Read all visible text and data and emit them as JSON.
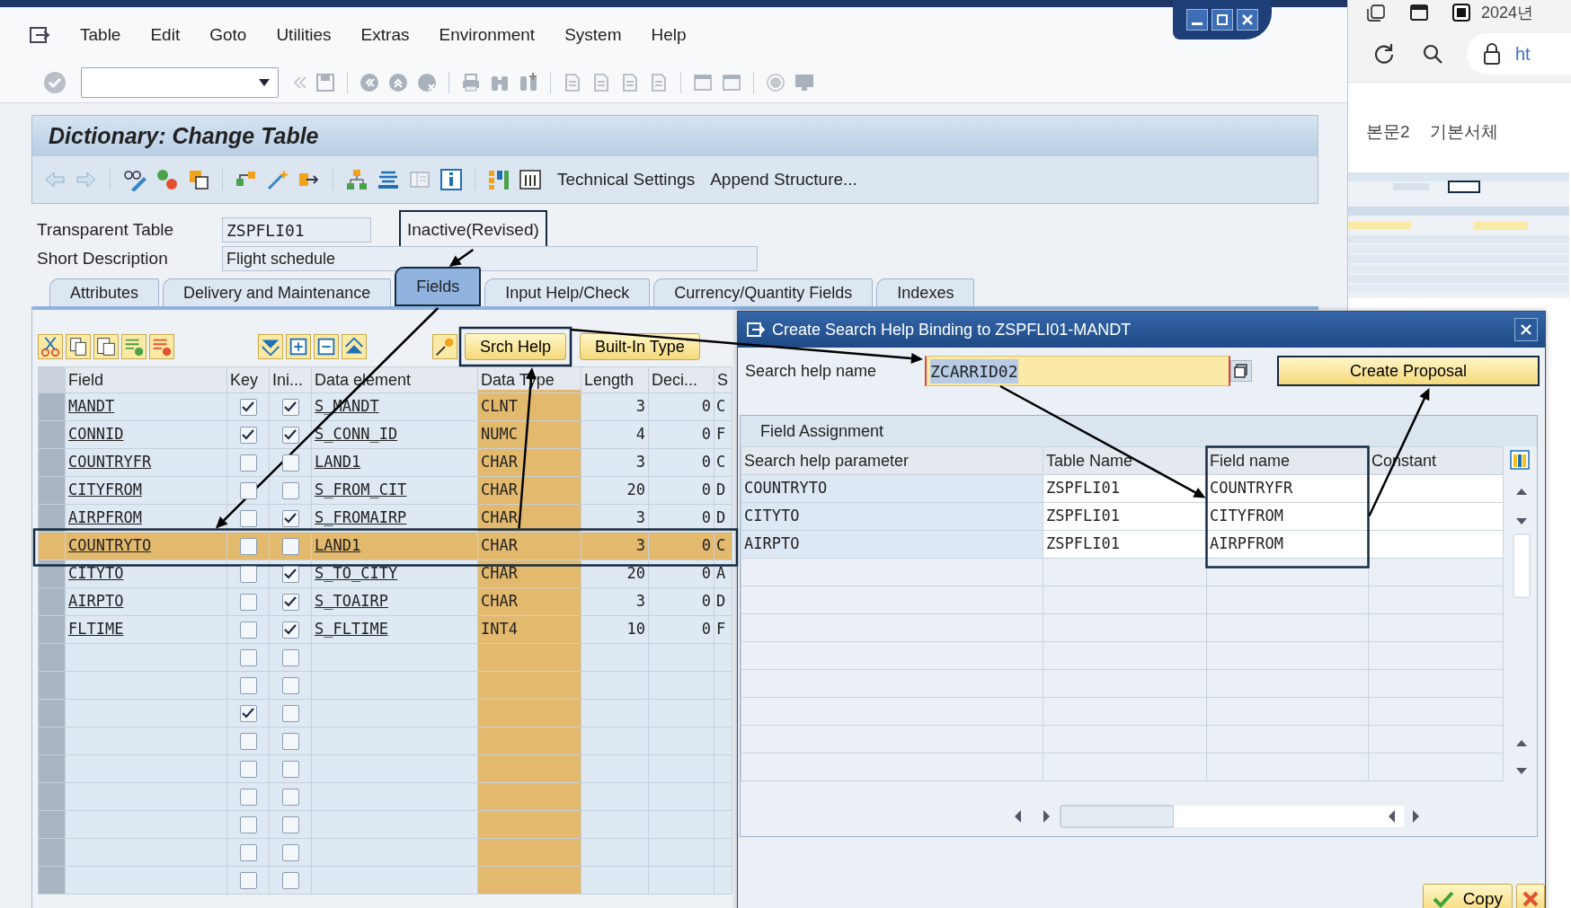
{
  "menu": [
    "Table",
    "Edit",
    "Goto",
    "Utilities",
    "Extras",
    "Environment",
    "System",
    "Help"
  ],
  "screen_title": "Dictionary: Change Table",
  "app_toolbar": [
    "Technical Settings",
    "Append Structure..."
  ],
  "header_fields": [
    {
      "label": "Transparent Table",
      "value": "ZSPFLI01",
      "status": "Inactive(Revised)"
    },
    {
      "label": "Short Description",
      "value": "Flight schedule"
    }
  ],
  "tabs": [
    {
      "label": "Attributes",
      "selected": false
    },
    {
      "label": "Delivery and Maintenance",
      "selected": false
    },
    {
      "label": "Fields",
      "selected": true
    },
    {
      "label": "Input Help/Check",
      "selected": false
    },
    {
      "label": "Currency/Quantity Fields",
      "selected": false
    },
    {
      "label": "Indexes",
      "selected": false
    }
  ],
  "grid_buttons": [
    "Srch Help",
    "Built-In Type"
  ],
  "grid": {
    "columns": [
      {
        "label": "Field",
        "highlighted": false
      },
      {
        "label": "Key",
        "highlighted": false
      },
      {
        "label": "Ini...",
        "highlighted": false
      },
      {
        "label": "Data element",
        "highlighted": false
      },
      {
        "label": "Data Type",
        "highlighted": true
      },
      {
        "label": "Length",
        "highlighted": false
      },
      {
        "label": "Deci...",
        "highlighted": false
      },
      {
        "label": "S",
        "highlighted": false
      }
    ],
    "rows": [
      {
        "field": "MANDT",
        "key": true,
        "initial": true,
        "data_element": "S_MANDT",
        "data_type": "CLNT",
        "length": "3",
        "decimals": "0",
        "short_text": "C",
        "selected": false
      },
      {
        "field": "CONNID",
        "key": true,
        "initial": true,
        "data_element": "S_CONN_ID",
        "data_type": "NUMC",
        "length": "4",
        "decimals": "0",
        "short_text": "F",
        "selected": false
      },
      {
        "field": "COUNTRYFR",
        "key": false,
        "initial": false,
        "data_element": "LAND1",
        "data_type": "CHAR",
        "length": "3",
        "decimals": "0",
        "short_text": "C",
        "selected": false
      },
      {
        "field": "CITYFROM",
        "key": false,
        "initial": false,
        "data_element": "S_FROM_CIT",
        "data_type": "CHAR",
        "length": "20",
        "decimals": "0",
        "short_text": "D",
        "selected": false
      },
      {
        "field": "AIRPFROM",
        "key": false,
        "initial": true,
        "data_element": "S_FROMAIRP",
        "data_type": "CHAR",
        "length": "3",
        "decimals": "0",
        "short_text": "D",
        "selected": false
      },
      {
        "field": "COUNTRYTO",
        "key": false,
        "initial": false,
        "data_element": "LAND1",
        "data_type": "CHAR",
        "length": "3",
        "decimals": "0",
        "short_text": "C",
        "selected": true
      },
      {
        "field": "CITYTO",
        "key": false,
        "initial": true,
        "data_element": "S_TO_CITY",
        "data_type": "CHAR",
        "length": "20",
        "decimals": "0",
        "short_text": "A",
        "selected": false
      },
      {
        "field": "AIRPTO",
        "key": false,
        "initial": true,
        "data_element": "S_TOAIRP",
        "data_type": "CHAR",
        "length": "3",
        "decimals": "0",
        "short_text": "D",
        "selected": false
      },
      {
        "field": "FLTIME",
        "key": false,
        "initial": true,
        "data_element": "S_FLTIME",
        "data_type": "INT4",
        "length": "10",
        "decimals": "0",
        "short_text": "F",
        "selected": false
      },
      {
        "key": false,
        "initial": false,
        "selected": false
      },
      {
        "key": false,
        "initial": false,
        "selected": false
      },
      {
        "key": true,
        "initial": false,
        "selected": false
      },
      {
        "key": false,
        "initial": false,
        "selected": false
      },
      {
        "key": false,
        "initial": false,
        "selected": false
      },
      {
        "key": false,
        "initial": false,
        "selected": false
      },
      {
        "key": false,
        "initial": false,
        "selected": false
      },
      {
        "key": false,
        "initial": false,
        "selected": false
      },
      {
        "key": false,
        "initial": false,
        "selected": false
      }
    ]
  },
  "dialog": {
    "title": "Create Search Help Binding to ZSPFLI01-MANDT",
    "search_help": {
      "label": "Search help name",
      "value": "ZCARRID02"
    },
    "create_button": "Create Proposal",
    "panel_title": "Field Assignment",
    "columns": [
      "Search help parameter",
      "Table Name",
      "Field name",
      "Constant"
    ],
    "rows": [
      {
        "parameter": "COUNTRYTO",
        "table": "ZSPFLI01",
        "field": "COUNTRYFR"
      },
      {
        "parameter": "CITYTO",
        "table": "ZSPFLI01",
        "field": "CITYFROM"
      },
      {
        "parameter": "AIRPTO",
        "table": "ZSPFLI01",
        "field": "AIRPFROM"
      }
    ],
    "copy_button": "Copy"
  },
  "browser": {
    "tab_title": "2024년",
    "address": "ht",
    "toolbar": [
      "본문2",
      "기본서체"
    ]
  }
}
